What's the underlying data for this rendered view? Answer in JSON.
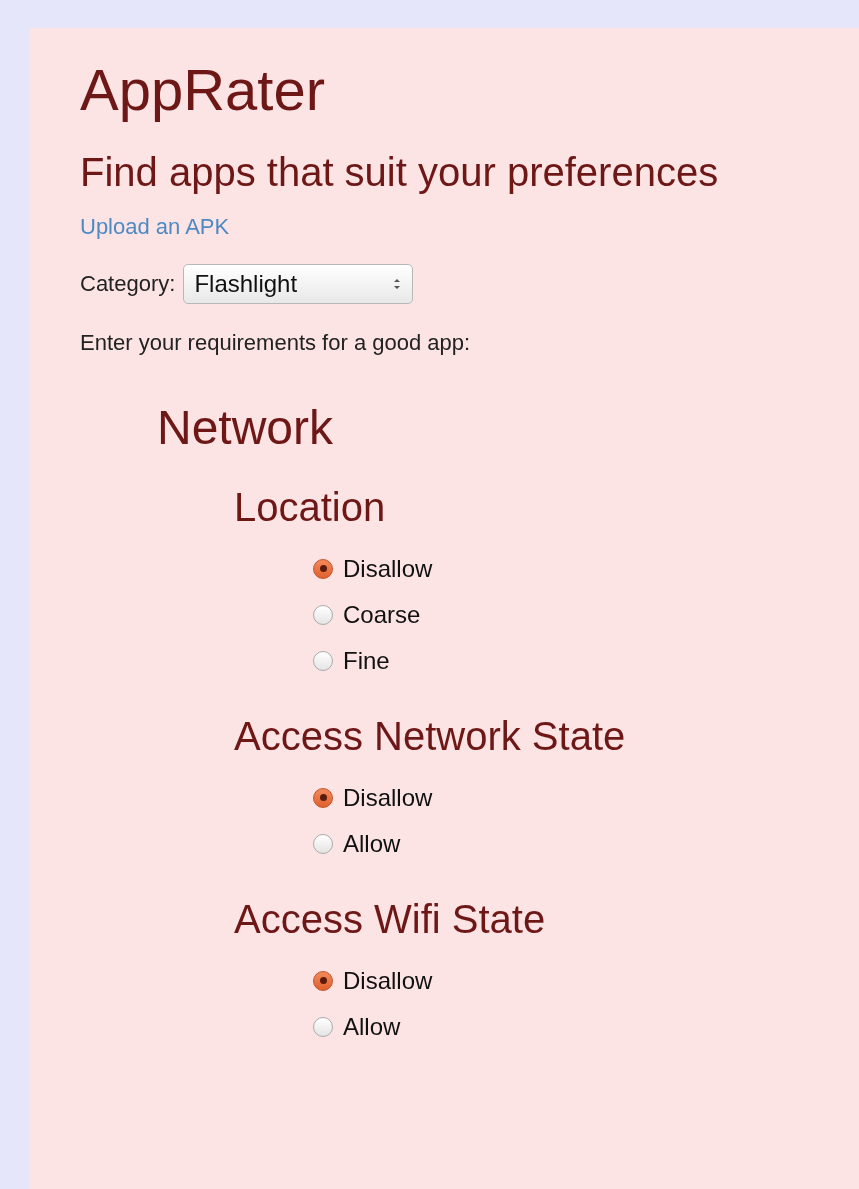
{
  "title": "AppRater",
  "subtitle": "Find apps that suit your preferences",
  "upload_link": "Upload an APK",
  "category": {
    "label": "Category:",
    "value": "Flashlight"
  },
  "instructions": "Enter your requirements for a good app:",
  "sections": [
    {
      "title": "Network",
      "permissions": [
        {
          "title": "Location",
          "options": [
            {
              "label": "Disallow",
              "selected": true
            },
            {
              "label": "Coarse",
              "selected": false
            },
            {
              "label": "Fine",
              "selected": false
            }
          ]
        },
        {
          "title": "Access Network State",
          "options": [
            {
              "label": "Disallow",
              "selected": true
            },
            {
              "label": "Allow",
              "selected": false
            }
          ]
        },
        {
          "title": "Access Wifi State",
          "options": [
            {
              "label": "Disallow",
              "selected": true
            },
            {
              "label": "Allow",
              "selected": false
            }
          ]
        }
      ]
    }
  ]
}
